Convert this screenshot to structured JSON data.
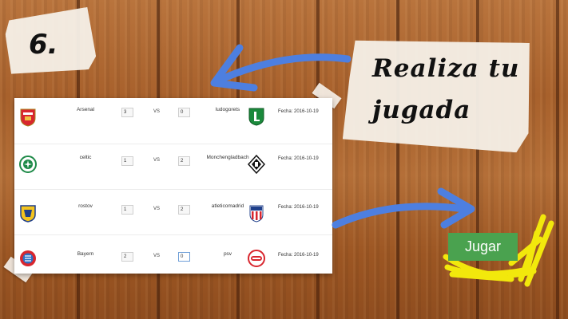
{
  "step": {
    "number": "6."
  },
  "title": {
    "line1": "Realiza tu",
    "line2": "jugada"
  },
  "matches": [
    {
      "home": "Arsenal",
      "home_score": "3",
      "vs": "VS",
      "away": "ludogorets",
      "away_score": "0",
      "date": "Fecha: 2016-10-19"
    },
    {
      "home": "celtic",
      "home_score": "1",
      "vs": "VS",
      "away": "Monchengladbach",
      "away_score": "2",
      "date": "Fecha: 2016-10-19"
    },
    {
      "home": "rostov",
      "home_score": "1",
      "vs": "VS",
      "away": "atleticomadrid",
      "away_score": "2",
      "date": "Fecha: 2016-10-19"
    },
    {
      "home": "Bayern",
      "home_score": "2",
      "vs": "VS",
      "away": "psv",
      "away_score": "0",
      "date": "Fecha: 2016-10-19"
    }
  ],
  "action": {
    "label": "Jugar"
  },
  "colors": {
    "arrow": "#4d7fe0",
    "highlight": "#f2e80c",
    "button": "#4aa24f"
  }
}
